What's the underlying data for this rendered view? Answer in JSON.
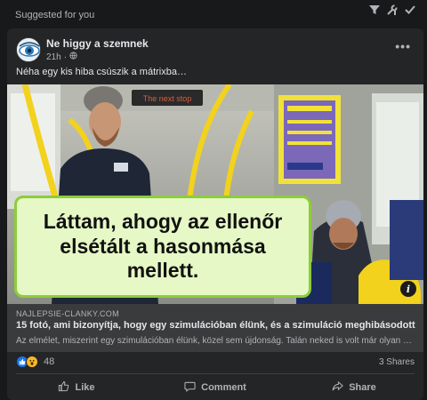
{
  "feed": {
    "suggested_label": "Suggested for you",
    "header_icons": [
      "filter-icon",
      "tools-icon",
      "check-icon"
    ]
  },
  "post": {
    "page_name": "Ne higgy a szemnek",
    "time": "21h",
    "audience_icon": "globe-icon",
    "more_label": "•••",
    "text": "Néha egy kis hiba csúszik a mátrixba…",
    "image": {
      "sign_text": "The next stop",
      "caption": "Láttam, ahogy az ellenőr elsétált a hasonmása mellett."
    },
    "link": {
      "domain": "NAJLEPSIE-CLANKY.COM",
      "title": "15 fotó, ami bizonyítja, hogy egy szimulációban élünk, és a szimuláció meghibásodott",
      "description": "Az elmélet, miszerint egy szimulációban élünk, közel sem újdonság. Talán neked is volt már olyan pill…"
    },
    "reactions": {
      "icons": [
        "like-icon",
        "wow-icon"
      ],
      "count": "48"
    },
    "shares": "3 Shares",
    "actions": {
      "like": "Like",
      "comment": "Comment",
      "share": "Share"
    }
  },
  "colors": {
    "background": "#18191a",
    "card": "#242526",
    "link_preview": "#3a3b3c",
    "caption_bg": "#e6f8c5",
    "caption_border": "#8ccd3a",
    "like_blue": "#1877f2",
    "wow_yellow": "#f7b928"
  }
}
